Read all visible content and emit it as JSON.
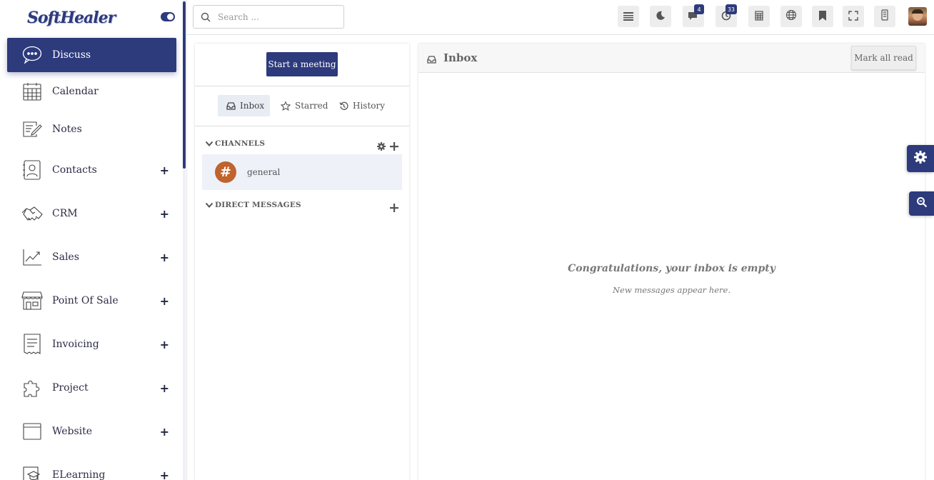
{
  "brand": {
    "name": "SoftHealer"
  },
  "sidebar": {
    "items": [
      {
        "label": "Discuss",
        "icon": "chat-bubble-icon",
        "active": true,
        "expandable": false
      },
      {
        "label": "Calendar",
        "icon": "calendar-icon",
        "active": false,
        "expandable": false
      },
      {
        "label": "Notes",
        "icon": "notes-icon",
        "active": false,
        "expandable": false
      },
      {
        "label": "Contacts",
        "icon": "contacts-icon",
        "active": false,
        "expandable": true
      },
      {
        "label": "CRM",
        "icon": "handshake-icon",
        "active": false,
        "expandable": true
      },
      {
        "label": "Sales",
        "icon": "line-chart-icon",
        "active": false,
        "expandable": true
      },
      {
        "label": "Point Of Sale",
        "icon": "storefront-icon",
        "active": false,
        "expandable": true
      },
      {
        "label": "Invoicing",
        "icon": "receipt-icon",
        "active": false,
        "expandable": true
      },
      {
        "label": "Project",
        "icon": "puzzle-icon",
        "active": false,
        "expandable": true
      },
      {
        "label": "Website",
        "icon": "browser-window-icon",
        "active": false,
        "expandable": true
      },
      {
        "label": "ELearning",
        "icon": "graduation-cap-icon",
        "active": false,
        "expandable": true
      }
    ],
    "plus_glyph": "+"
  },
  "topbar": {
    "search_placeholder": "Search ...",
    "buttons": [
      {
        "icon": "list-settings-icon"
      },
      {
        "icon": "moon-theme-icon"
      },
      {
        "icon": "messages-icon",
        "badge": "4"
      },
      {
        "icon": "activity-clock-icon",
        "badge": "33"
      },
      {
        "icon": "calculator-icon"
      },
      {
        "icon": "language-globe-icon"
      },
      {
        "icon": "bookmark-icon"
      },
      {
        "icon": "fullscreen-icon"
      },
      {
        "icon": "mobile-device-icon"
      }
    ],
    "avatar_icon": "user-avatar"
  },
  "discuss": {
    "start_meeting_label": "Start a meeting",
    "tabs": [
      {
        "label": "Inbox",
        "icon": "inbox-icon",
        "active": true
      },
      {
        "label": "Starred",
        "icon": "star-icon",
        "active": false
      },
      {
        "label": "History",
        "icon": "history-icon",
        "active": false
      }
    ],
    "channels_heading": "CHANNELS",
    "channels": [
      {
        "name": "general",
        "glyph": "#"
      }
    ],
    "direct_messages_heading": "DIRECT MESSAGES"
  },
  "inbox": {
    "title": "Inbox",
    "mark_all_read_label": "Mark all read",
    "empty_title": "Congratulations, your inbox is empty",
    "empty_subtitle": "New messages appear here."
  },
  "colors": {
    "primary": "#2d3a7c",
    "channel_avatar": "#c0632c",
    "active_channel_bg": "#eef1f8"
  }
}
